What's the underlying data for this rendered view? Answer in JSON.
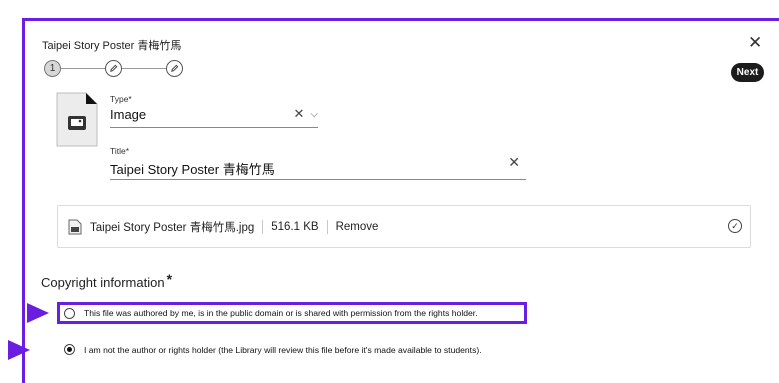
{
  "dialog": {
    "title": "Taipei Story Poster 青梅竹馬",
    "close_icon": "close-icon",
    "next_label": "Next"
  },
  "stepper": {
    "steps": [
      {
        "label": "1",
        "state": "current"
      },
      {
        "icon": "pencil-icon",
        "state": "pending"
      },
      {
        "icon": "pencil-icon",
        "state": "pending"
      }
    ]
  },
  "form": {
    "type_label": "Type*",
    "type_value": "Image",
    "title_label": "Title*",
    "title_value": "Taipei Story Poster 青梅竹馬"
  },
  "file": {
    "name": "Taipei Story Poster 青梅竹馬.jpg",
    "size": "516.1 KB",
    "remove_label": "Remove"
  },
  "copyright": {
    "heading": "Copyright information",
    "required_mark": "*",
    "options": [
      {
        "label": "This file was authored by me, is in the public domain or is shared with permission from the rights holder.",
        "checked": false
      },
      {
        "label": "I am not the author or rights holder (the Library will review this file before it's made available to students).",
        "checked": true
      }
    ]
  },
  "colors": {
    "highlight": "#6a1fe0",
    "button_bg": "#1c1c1c"
  }
}
